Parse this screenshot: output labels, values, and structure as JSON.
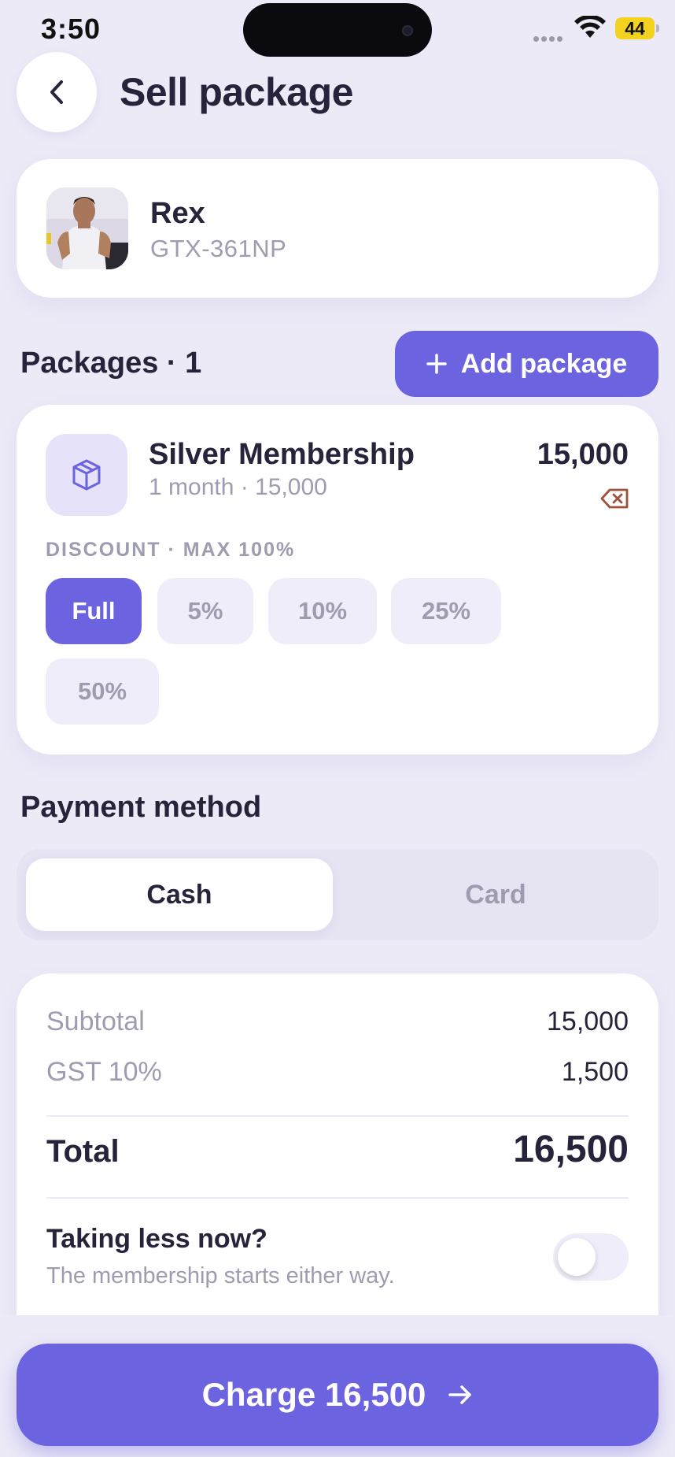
{
  "status_bar": {
    "time": "3:50",
    "battery": "44"
  },
  "header": {
    "title": "Sell package"
  },
  "client": {
    "name": "Rex",
    "code": "GTX-361NP"
  },
  "packages": {
    "title": "Packages · 1",
    "add_label": "Add package",
    "items": [
      {
        "name": "Silver Membership",
        "subtitle": "1 month · 15,000",
        "price": "15,000",
        "discount_label": "DISCOUNT · MAX 100%",
        "discount_options": [
          "Full",
          "5%",
          "10%",
          "25%",
          "50%"
        ],
        "selected_discount": "Full"
      }
    ]
  },
  "payment": {
    "title": "Payment method",
    "options": [
      "Cash",
      "Card"
    ],
    "selected": "Cash"
  },
  "summary": {
    "subtotal_label": "Subtotal",
    "subtotal_value": "15,000",
    "gst_label": "GST 10%",
    "gst_value": "1,500",
    "total_label": "Total",
    "total_value": "16,500",
    "less_title": "Taking less now?",
    "less_subtitle": "The membership starts either way.",
    "less_toggle_on": false
  },
  "cta": {
    "label": "Charge 16,500"
  },
  "colors": {
    "accent": "#6c63e0",
    "background": "#eceaf7",
    "card": "#ffffff",
    "muted_text": "#9e9cb0",
    "primary_text": "#26233b",
    "remove_icon": "#a0523a"
  }
}
